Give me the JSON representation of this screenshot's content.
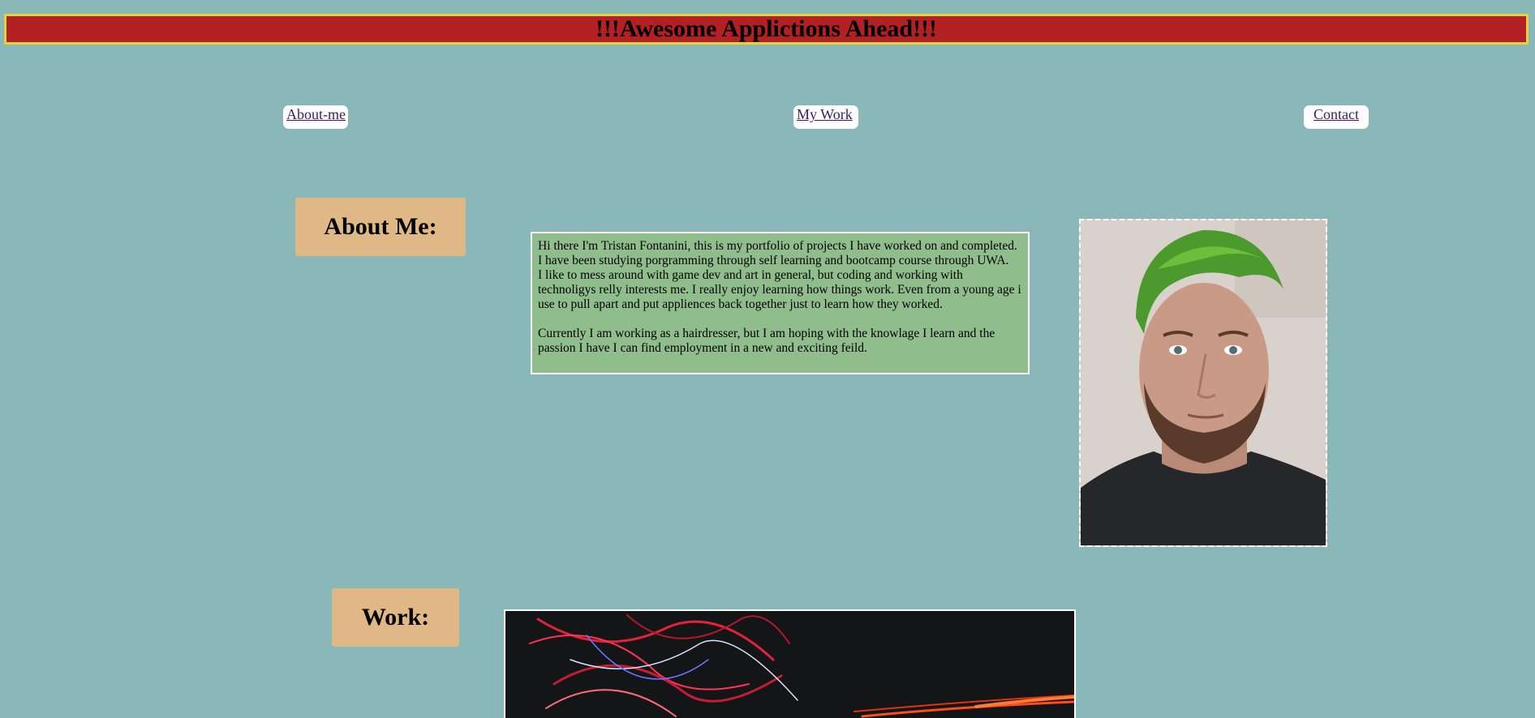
{
  "header": {
    "title": "!!!Awesome Applictions Ahead!!!"
  },
  "nav": {
    "about_label": "About-me",
    "work_label": "My Work",
    "contact_label": "Contact"
  },
  "about": {
    "heading": "About Me:",
    "paragraph1": "Hi there I'm Tristan Fontanini, this is my portfolio of projects I have worked on and completed. I have been studying porgramming through self learning and bootcamp course through UWA.",
    "paragraph2": "I like to mess around with game dev and art in general, but coding and working with technoligys relly interests me. I really enjoy learning how things work. Even from a young age i use to pull apart and put appliences back together just to learn how they worked.",
    "paragraph3": "Currently I am working as a hairdresser, but I am hoping with the knowlage I learn and the passion I have I can find employment in a new and exciting feild."
  },
  "work": {
    "heading": "Work:"
  },
  "colors": {
    "background": "#8ab7b7",
    "header_bg": "#b22024",
    "header_border": "#e0d43a",
    "label_bg": "#dfb886",
    "about_text_bg": "#8fbd8b"
  }
}
